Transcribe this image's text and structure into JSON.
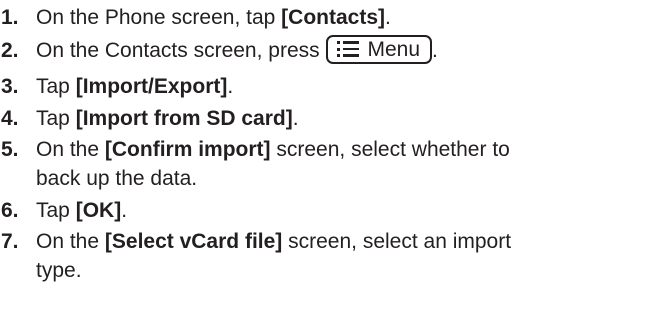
{
  "steps": [
    {
      "number": "1.",
      "before": "On the Phone screen, tap ",
      "bold": "[Contacts]",
      "after": "."
    },
    {
      "number": "2.",
      "before": "On the Contacts screen, press ",
      "key_label": "Menu",
      "key_icon": "menu-list-icon",
      "after": "."
    },
    {
      "number": "3.",
      "before": "Tap ",
      "bold": "[Import/Export]",
      "after": "."
    },
    {
      "number": "4.",
      "before": "Tap ",
      "bold": "[Import from SD card]",
      "after": "."
    },
    {
      "number": "5.",
      "before": "On the ",
      "bold": "[Confirm import]",
      "after": " screen, select whether to",
      "continuation": "back up the data."
    },
    {
      "number": "6.",
      "before": "Tap ",
      "bold": "[OK]",
      "after": "."
    },
    {
      "number": "7.",
      "before": "On the ",
      "bold": "[Select vCard file]",
      "after": " screen, select an import",
      "continuation": "type."
    }
  ]
}
